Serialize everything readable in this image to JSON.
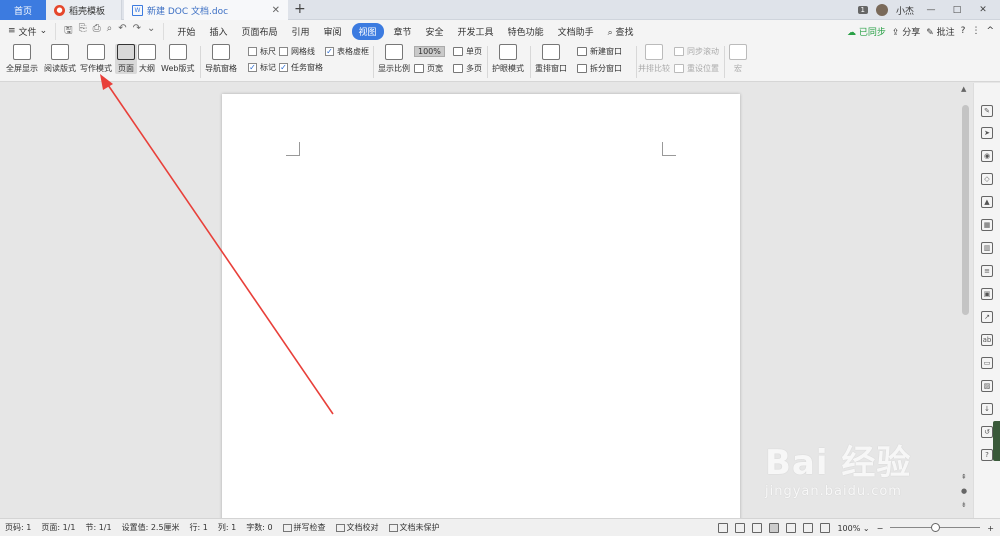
{
  "titlebar": {
    "tabs": [
      {
        "label": "首页"
      },
      {
        "label": "稻壳模板"
      },
      {
        "label": "新建 DOC 文档.doc"
      }
    ],
    "new_tab": "+",
    "badge": "1",
    "user_name": "小杰",
    "window_buttons": [
      "—",
      "□",
      "✕"
    ]
  },
  "menu": {
    "file_label": "文件",
    "items": [
      "开始",
      "插入",
      "页面布局",
      "引用",
      "审阅",
      "视图",
      "章节",
      "安全",
      "开发工具",
      "特色功能",
      "文档助手"
    ],
    "active": "视图",
    "search_label": "查找",
    "right": {
      "sync": "已同步",
      "share": "分享",
      "comment": "批注",
      "help": "?",
      "more": "⋮",
      "collapse": "^"
    }
  },
  "ribbon": {
    "fullscreen": "全屏显示",
    "reading": "阅读版式",
    "writing": "写作模式",
    "page": "页面",
    "outline": "大纲",
    "web": "Web版式",
    "nav_pane": "导航窗格",
    "ruler": "标尺",
    "gridlines": "网格线",
    "table_dashed": "表格虚框",
    "marks": "标记",
    "task_pane": "任务窗格",
    "zoom": "显示比例",
    "zoom_100": "100%",
    "page_width": "页宽",
    "single_page": "单页",
    "multi_page": "多页",
    "eye_mode": "护眼模式",
    "arrange": "重排窗口",
    "new_window": "新建窗口",
    "split_window": "拆分窗口",
    "side_by_side": "并排比较",
    "sync_scroll": "同步滚动",
    "reset_position": "重设位置",
    "macro": "宏"
  },
  "checkboxes": {
    "ruler": false,
    "gridlines": false,
    "table_dashed": true,
    "marks": true,
    "task_pane": true
  },
  "sidepanel_icons": [
    "pen-icon",
    "cursor-icon",
    "pin-icon",
    "shapes-icon",
    "drop-icon",
    "table-icon",
    "chart-icon",
    "filter-icon",
    "image-library-icon",
    "export-icon",
    "translate-icon",
    "archive-icon",
    "picture-icon",
    "download-icon",
    "history-icon",
    "help-icon"
  ],
  "status": {
    "page_num": "页码: 1",
    "pages": "页面: 1/1",
    "section": "节: 1/1",
    "setting": "设置值: 2.5厘米",
    "row": "行: 1",
    "col": "列: 1",
    "words": "字数: 0",
    "spell": "拼写检查",
    "proof": "文档校对",
    "protect": "文档未保护",
    "zoom": "100%",
    "zoom_level": 0.5,
    "minus": "−",
    "plus": "+"
  },
  "watermark": {
    "brand": "Bai 经验",
    "url": "jingyan.baidu.com"
  },
  "colors": {
    "accent": "#3c7be0",
    "annotation_arrow": "#e8403a"
  }
}
